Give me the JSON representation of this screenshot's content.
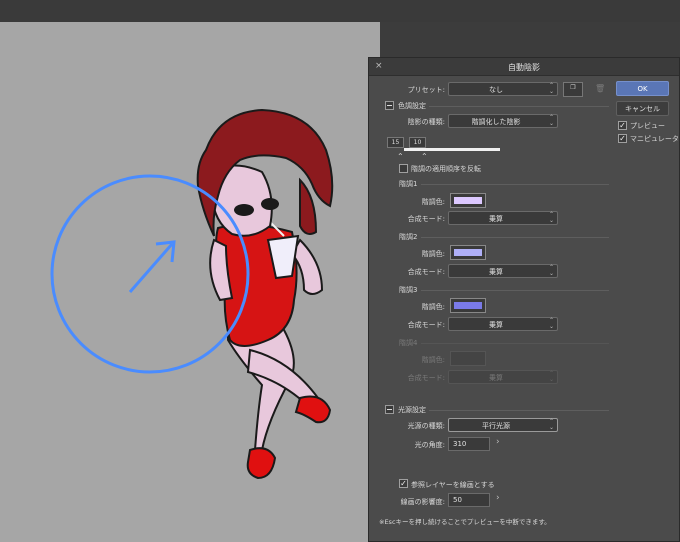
{
  "dialog": {
    "title": "自動陰影",
    "close_icon": "×",
    "preset_label": "プリセット:",
    "preset_value": "なし",
    "ok_label": "OK",
    "cancel_label": "キャンセル",
    "preview_label": "プレビュー",
    "manipulator_label": "マニピュレータ",
    "tone_section": "色調設定",
    "shadow_type_label": "陰影の種類:",
    "shadow_type_value": "階調化した陰影",
    "slider_a": "15",
    "slider_b": "10",
    "reverse_order_label": "階調の適用順序を反転",
    "tones": [
      {
        "name": "階調1",
        "color_label": "階調色:",
        "mode_label": "合成モード:",
        "mode_value": "乗算",
        "color": "#dcc8ff"
      },
      {
        "name": "階調2",
        "color_label": "階調色:",
        "mode_label": "合成モード:",
        "mode_value": "乗算",
        "color": "#b0b0f8"
      },
      {
        "name": "階調3",
        "color_label": "階調色:",
        "mode_label": "合成モード:",
        "mode_value": "乗算",
        "color": "#7a7ae8"
      },
      {
        "name": "階調4",
        "color_label": "階調色:",
        "mode_label": "合成モード:",
        "mode_value": "乗算",
        "color": ""
      }
    ],
    "light_section": "光源設定",
    "light_type_label": "光源の種類:",
    "light_type_value": "平行光源",
    "light_angle_label": "光の角度:",
    "light_angle_value": "310",
    "ref_layer_label": "参照レイヤーを線画とする",
    "line_influence_label": "線画の影響度:",
    "line_influence_value": "50",
    "footer_note": "※Escキーを押し続けることでプレビューを中断できます。"
  },
  "colors": {
    "accent": "#5a76b6",
    "manipulator_circle": "#4a8cff"
  }
}
